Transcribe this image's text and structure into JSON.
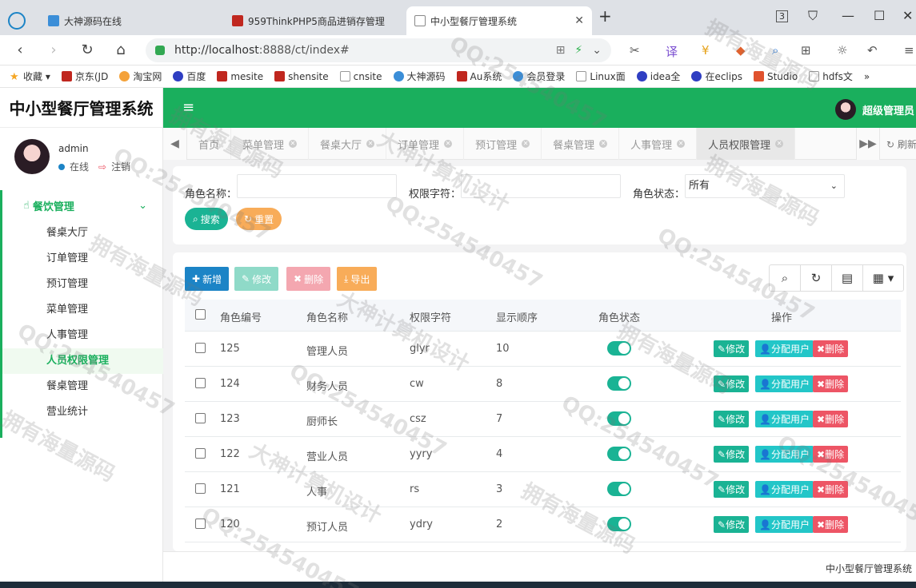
{
  "browser": {
    "tabs": [
      {
        "title": "大神源码在线",
        "active": false
      },
      {
        "title": "959ThinkPHP5商品进销存管理",
        "active": false
      },
      {
        "title": "中小型餐厅管理系统",
        "active": true
      }
    ],
    "url_host": "http://localhost",
    "url_rest": ":8888/ct/index#",
    "bookmarks": [
      "收藏",
      "京东(JD",
      "淘宝网",
      "百度",
      "mesite",
      "shensite",
      "cnsite",
      "大神源码",
      "Au系统",
      "会员登录",
      "Linux面",
      "idea全",
      "在eclips",
      "Studio",
      "hdfs文"
    ],
    "more": "»"
  },
  "app": {
    "brand": "中小型餐厅管理系统",
    "user_name": "admin",
    "status_online": "在线",
    "logout": "注销",
    "top_user": "超级管理员"
  },
  "sidebar": {
    "group": "餐饮管理",
    "items": [
      {
        "label": "餐桌大厅",
        "active": false
      },
      {
        "label": "订单管理",
        "active": false
      },
      {
        "label": "预订管理",
        "active": false
      },
      {
        "label": "菜单管理",
        "active": false
      },
      {
        "label": "人事管理",
        "active": false
      },
      {
        "label": "人员权限管理",
        "active": true
      },
      {
        "label": "餐桌管理",
        "active": false
      },
      {
        "label": "营业统计",
        "active": false
      }
    ]
  },
  "page_tabs": [
    {
      "label": "首页",
      "closable": false
    },
    {
      "label": "菜单管理",
      "closable": true
    },
    {
      "label": "餐桌大厅",
      "closable": true
    },
    {
      "label": "订单管理",
      "closable": true
    },
    {
      "label": "预订管理",
      "closable": true
    },
    {
      "label": "餐桌管理",
      "closable": true
    },
    {
      "label": "人事管理",
      "closable": true
    },
    {
      "label": "人员权限管理",
      "closable": true,
      "active": true
    }
  ],
  "refresh_label": "刷新",
  "search": {
    "role_name_label": "角色名称：",
    "perm_label": "权限字符：",
    "status_label": "角色状态：",
    "status_value": "所有",
    "search_btn": "搜索",
    "reset_btn": "重置"
  },
  "toolbar": {
    "add": "新增",
    "edit": "修改",
    "delete": "删除",
    "export": "导出"
  },
  "table": {
    "headers": [
      "角色编号",
      "角色名称",
      "权限字符",
      "显示顺序",
      "角色状态",
      "操作"
    ],
    "rows": [
      {
        "id": "125",
        "name": "管理人员",
        "key": "glyr",
        "order": "10",
        "enabled": true
      },
      {
        "id": "124",
        "name": "财务人员",
        "key": "cw",
        "order": "8",
        "enabled": true
      },
      {
        "id": "123",
        "name": "厨师长",
        "key": "csz",
        "order": "7",
        "enabled": true
      },
      {
        "id": "122",
        "name": "营业人员",
        "key": "yyry",
        "order": "4",
        "enabled": true
      },
      {
        "id": "121",
        "name": "人事",
        "key": "rs",
        "order": "3",
        "enabled": true
      },
      {
        "id": "120",
        "name": "预订人员",
        "key": "ydry",
        "order": "2",
        "enabled": true
      }
    ],
    "row_actions": {
      "edit": "修改",
      "assign": "分配用户",
      "delete": "删除"
    }
  },
  "footer": "中小型餐厅管理系统",
  "watermarks": [
    "拥有海量源码",
    "QQ:254540457",
    "大神计算机设计"
  ],
  "colors": {
    "primary_green": "#1aaf5d",
    "teal": "#1ab394",
    "blue": "#1c84c6",
    "red": "#ed5565",
    "orange": "#f8ac59"
  }
}
